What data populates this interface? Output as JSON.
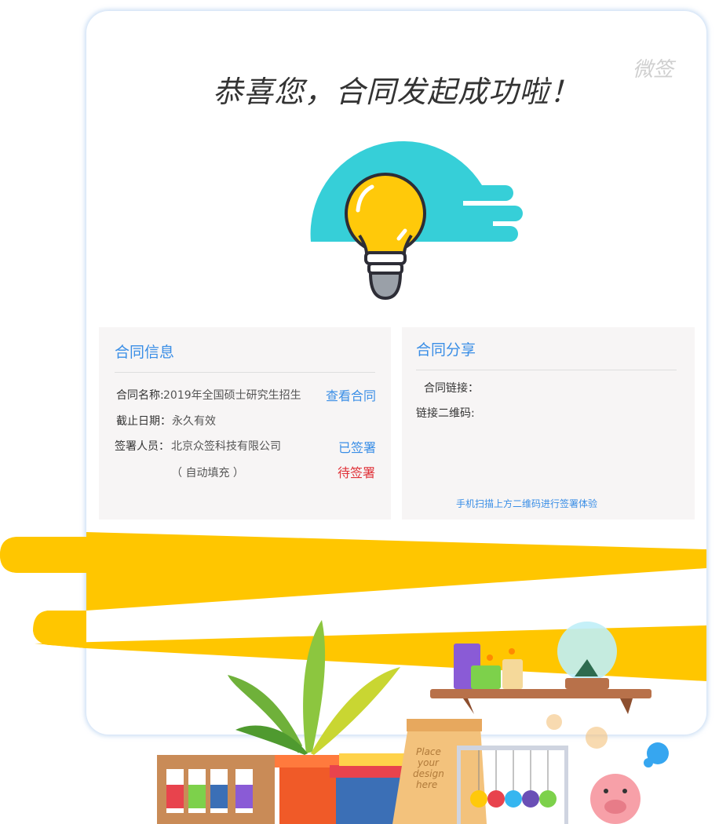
{
  "brand": "微签",
  "headline": "恭喜您，合同发起成功啦！",
  "info_panel": {
    "title": "合同信息",
    "name_label": "合同名称:",
    "name_value": "2019年全国硕士研究生招生",
    "view_contract": "查看合同",
    "deadline_label": "截止日期：",
    "deadline_value": "永久有效",
    "signer_label": "签署人员：",
    "signer_value": "北京众签科技有限公司",
    "signed_status": "已签署",
    "auto_fill": "（ 自动填充 ）",
    "pending_status": "待签署"
  },
  "share_panel": {
    "title": "合同分享",
    "link_label": "合同链接：",
    "qr_label": "链接二维码:",
    "scan_hint": "手机扫描上方二维码进行签署体验"
  },
  "illustration": {
    "box_text": [
      "Place",
      "your",
      "design",
      "here"
    ]
  },
  "colors": {
    "accent_blue": "#3a8ee6",
    "pending_red": "#e0333a",
    "banner_yellow": "#ffc600",
    "bulb_teal": "#36cfd8",
    "bulb_yellow": "#ffc90a"
  }
}
